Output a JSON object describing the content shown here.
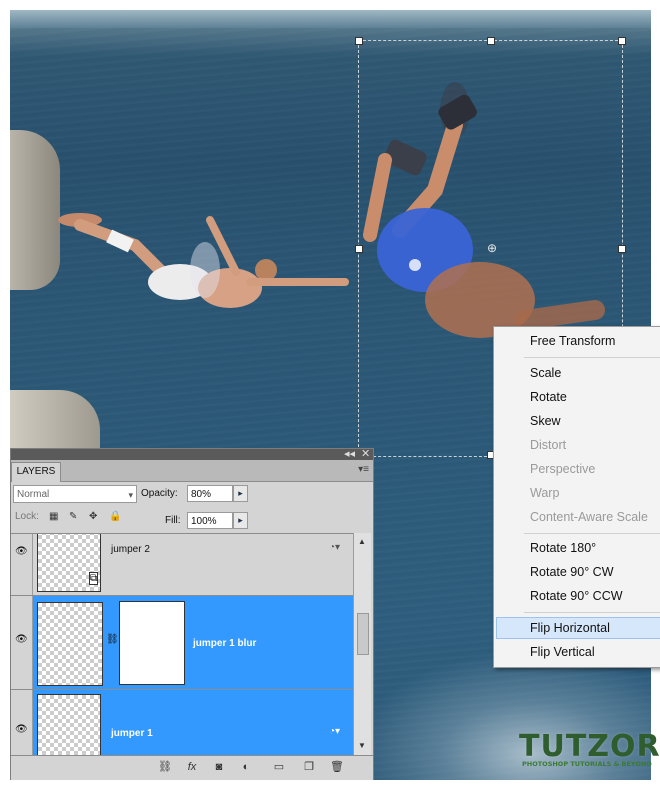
{
  "context_menu": {
    "items": [
      {
        "label": "Free Transform",
        "disabled": false
      },
      {
        "label": "Scale",
        "disabled": false
      },
      {
        "label": "Rotate",
        "disabled": false
      },
      {
        "label": "Skew",
        "disabled": false
      },
      {
        "label": "Distort",
        "disabled": true
      },
      {
        "label": "Perspective",
        "disabled": true
      },
      {
        "label": "Warp",
        "disabled": true
      },
      {
        "label": "Content-Aware Scale",
        "disabled": true
      },
      {
        "label": "Rotate 180°",
        "disabled": false
      },
      {
        "label": "Rotate 90° CW",
        "disabled": false
      },
      {
        "label": "Rotate 90° CCW",
        "disabled": false
      },
      {
        "label": "Flip Horizontal",
        "disabled": false,
        "highlighted": true
      },
      {
        "label": "Flip Vertical",
        "disabled": false
      }
    ]
  },
  "layers_panel": {
    "tab_label": "LAYERS",
    "blend_mode": "Normal",
    "opacity_label": "Opacity:",
    "opacity_value": "80%",
    "lock_label": "Lock:",
    "fill_label": "Fill:",
    "fill_value": "100%",
    "layers": [
      {
        "name": "jumper 2",
        "selected": false
      },
      {
        "name": "jumper 1 blur",
        "selected": true
      },
      {
        "name": "jumper 1",
        "selected": true
      }
    ],
    "selection_color": "#3399ff"
  },
  "watermark": {
    "logo": "TUTZOR",
    "tagline": "PHOTOSHOP TUTORIALS & BEYOND"
  },
  "icons": [
    "eye-icon",
    "link-icon",
    "lock-icon",
    "move-icon",
    "fx-icon",
    "mask-icon",
    "adjustment-icon",
    "folder-icon",
    "new-layer-icon",
    "trash-icon"
  ]
}
